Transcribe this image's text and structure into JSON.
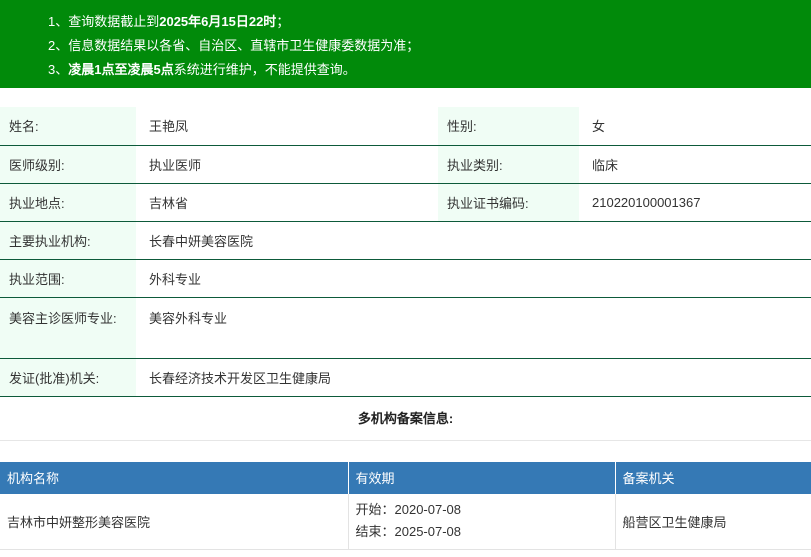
{
  "notice": [
    {
      "prefix": "1、查询数据截止到",
      "bold": "2025年6月15日22时",
      "suffix": "；"
    },
    {
      "prefix": "2、信息数据结果以各省、自治区、直辖市卫生健康委数据为准；",
      "bold": "",
      "suffix": ""
    },
    {
      "prefix": "3、",
      "bold": "凌晨1点至凌晨5点",
      "suffix": "系统进行维护，不能提供查询。"
    }
  ],
  "info": {
    "name_label": "姓名:",
    "name_value": "王艳凤",
    "gender_label": "性别:",
    "gender_value": "女",
    "level_label": "医师级别:",
    "level_value": "执业医师",
    "category_label": "执业类别:",
    "category_value": "临床",
    "location_label": "执业地点:",
    "location_value": "吉林省",
    "cert_label": "执业证书编码:",
    "cert_value": "210220100001367",
    "institution_label": "主要执业机构:",
    "institution_value": "长春中妍美容医院",
    "scope_label": "执业范围:",
    "scope_value": "外科专业",
    "cosmetic_label": "美容主诊医师专业:",
    "cosmetic_value": "美容外科专业",
    "authority_label": "发证(批准)机关:",
    "authority_value": "长春经济技术开发区卫生健康局"
  },
  "multi_title": "多机构备案信息:",
  "records": {
    "headers": [
      "机构名称",
      "有效期",
      "备案机关"
    ],
    "rows": [
      {
        "institution": "吉林市中妍整形美容医院",
        "start": "开始：2020-07-08",
        "end": "结束：2025-07-08",
        "authority": "船营区卫生健康局"
      }
    ]
  }
}
